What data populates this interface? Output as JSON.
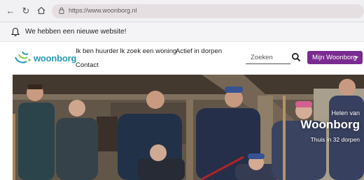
{
  "browser": {
    "url": "https://www.woonborg.nl",
    "icons": [
      "back-arrow-icon",
      "reload-icon",
      "home-icon",
      "lock-icon"
    ]
  },
  "notice": {
    "text": "We hebben een nieuwe website!",
    "icon": "bell-icon"
  },
  "header": {
    "logo_text": "woonborg",
    "nav": [
      "Ik ben huurder",
      "Ik zoek een woning",
      "Actief in dorpen",
      "Contact"
    ],
    "search_placeholder": "Zoeken",
    "account_label": "Mijn Woonborg",
    "accent_color": "#7a2b8f",
    "brand_color": "#2a9bb5"
  },
  "hero": {
    "overline": "Helen van",
    "title": "Woonborg",
    "subtitle": "Thuis in 32 dorpen"
  }
}
